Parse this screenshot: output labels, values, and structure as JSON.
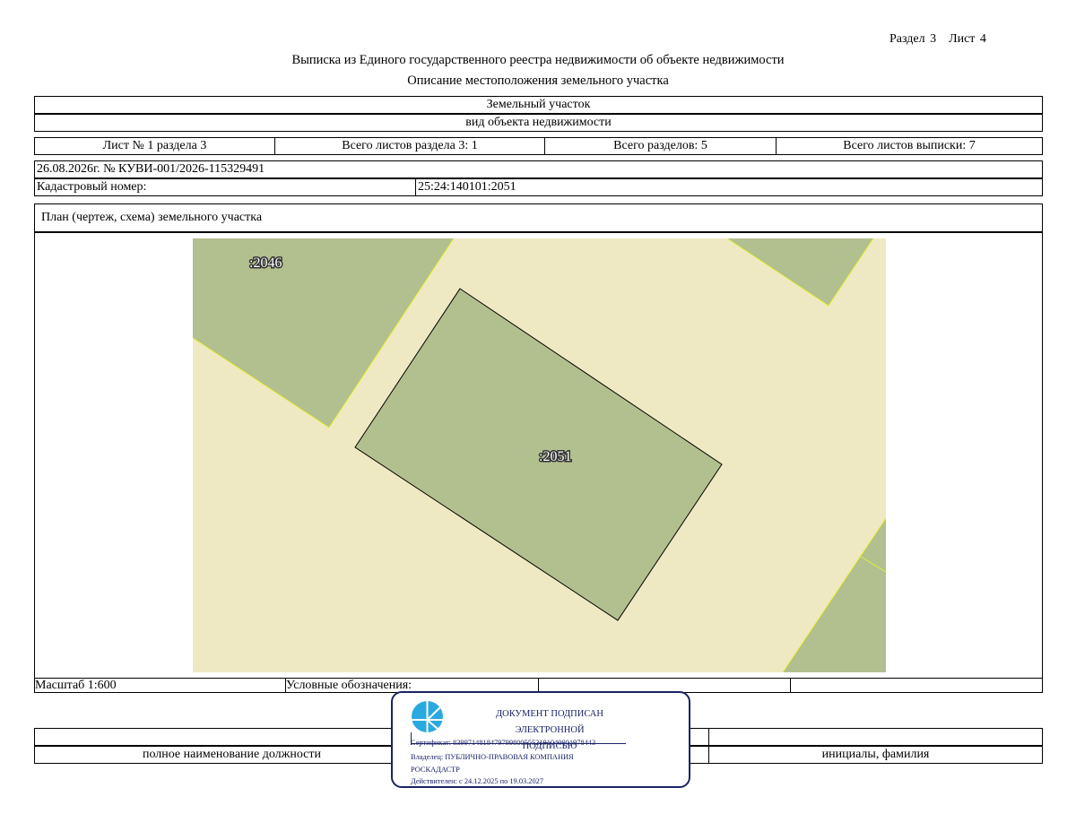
{
  "header": {
    "section": "Раздел 3",
    "sheet": "Лист 4",
    "title": "Выписка из Единого государственного реестра недвижимости об объекте недвижимости",
    "subtitle": "Описание местоположения земельного участка"
  },
  "object": {
    "type": "Земельный участок",
    "type_caption": "вид объекта недвижимости"
  },
  "sheets_row": {
    "sheet_no": "Лист № 1 раздела 3",
    "total_section_sheets": "Всего листов раздела 3: 1",
    "total_sections": "Всего разделов: 5",
    "total_extract_sheets": "Всего листов выписки: 7"
  },
  "record": {
    "date_number": "26.08.2026г. № КУВИ-001/2026-115329491",
    "cadastral_label": "Кадастровый номер:",
    "cadastral_value": "25:24:140101:2051"
  },
  "plan": {
    "title": "План (чертеж, схема) земельного участка",
    "parcel_labels": {
      "main": ":2051",
      "neighbor": ":2046"
    },
    "colors": {
      "background": "#efe9c3",
      "parcel": "#b2bf8f",
      "neighbor_edge": "#e3ef33"
    }
  },
  "legend_row": {
    "scale": "Масштаб 1:600",
    "legend": "Условные обозначения:"
  },
  "signature": {
    "position_caption": "полное наименование должности",
    "name_caption": "инициалы, фамилия"
  },
  "stamp": {
    "line1": "ДОКУМЕНТ ПОДПИСАН",
    "line2": "ЭЛЕКТРОННОЙ ПОДПИСЬЮ",
    "certificate": "Сертификат: 83997148184797998005552191040001978443",
    "owner1": "Владелец: ПУБЛИЧНО-ПРАВОВАЯ КОМПАНИЯ",
    "owner2": "РОСКАДАСТР",
    "validity": "Действителен: с 24.12.2025 по 19.03.2027",
    "icon": "roskadastr-logo-icon"
  }
}
